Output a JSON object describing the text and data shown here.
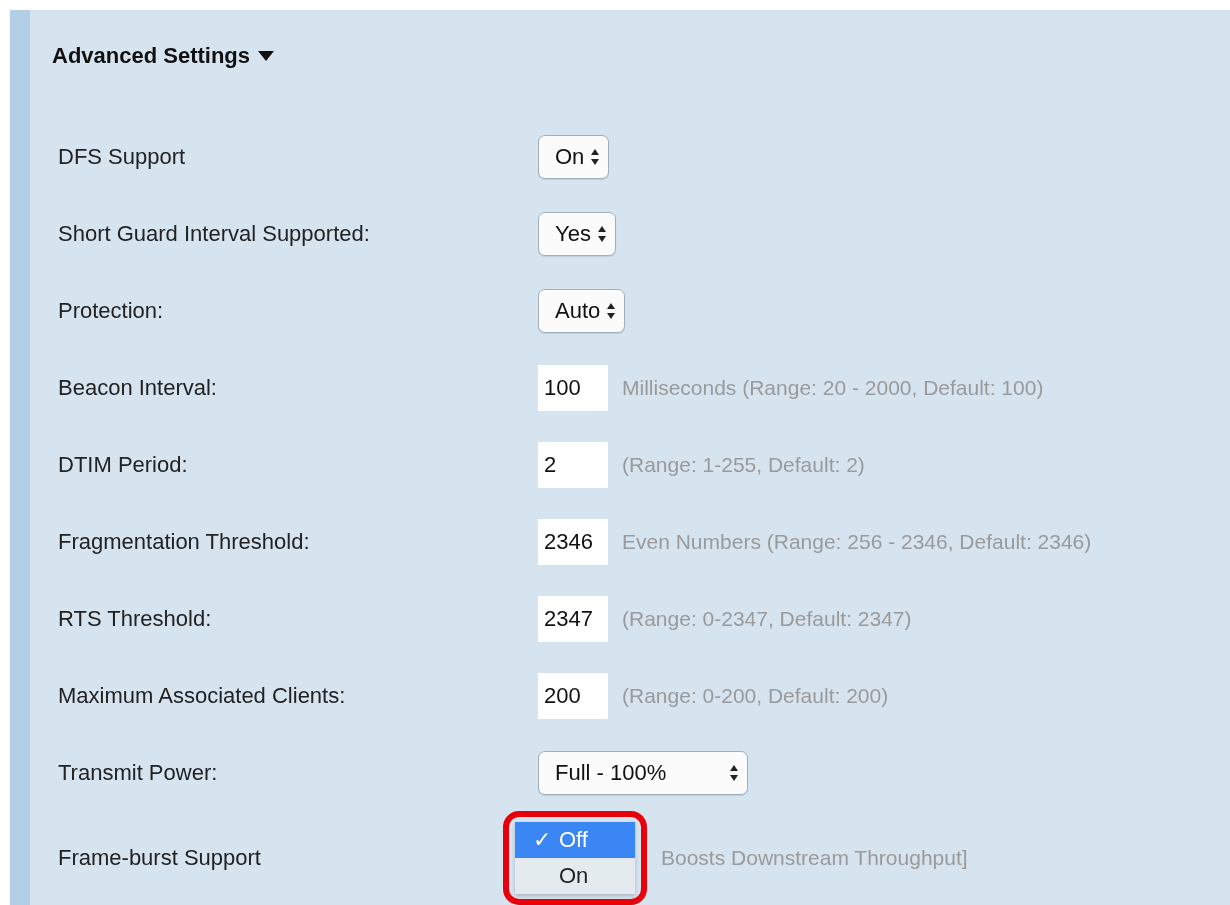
{
  "section": {
    "title": "Advanced Settings",
    "expanded": true
  },
  "rows": [
    {
      "kind": "select",
      "label": "DFS Support",
      "value": "On"
    },
    {
      "kind": "select",
      "label": "Short Guard Interval Supported:",
      "value": "Yes"
    },
    {
      "kind": "select",
      "label": "Protection:",
      "value": "Auto"
    },
    {
      "kind": "input",
      "label": "Beacon Interval:",
      "value": "100",
      "hint": "Milliseconds (Range: 20 - 2000, Default: 100)"
    },
    {
      "kind": "input",
      "label": "DTIM Period:",
      "value": "2",
      "hint": "(Range: 1-255, Default: 2)"
    },
    {
      "kind": "input",
      "label": "Fragmentation Threshold:",
      "value": "2346",
      "hint": "Even Numbers (Range: 256 - 2346, Default: 2346)"
    },
    {
      "kind": "input",
      "label": "RTS Threshold:",
      "value": "2347",
      "hint": "(Range: 0-2347, Default: 2347)"
    },
    {
      "kind": "input",
      "label": "Maximum Associated Clients:",
      "value": "200",
      "hint": "(Range: 0-200, Default: 200)"
    },
    {
      "kind": "select",
      "label": "Transmit Power:",
      "value": "Full - 100%",
      "wide": true
    },
    {
      "kind": "open-select",
      "label": "Frame-burst Support",
      "hint": "Boosts Downstream Throughput]",
      "highlighted": true,
      "options": [
        {
          "label": "Off",
          "check": "✓",
          "selected": true
        },
        {
          "label": "On",
          "selected": false
        }
      ]
    }
  ]
}
